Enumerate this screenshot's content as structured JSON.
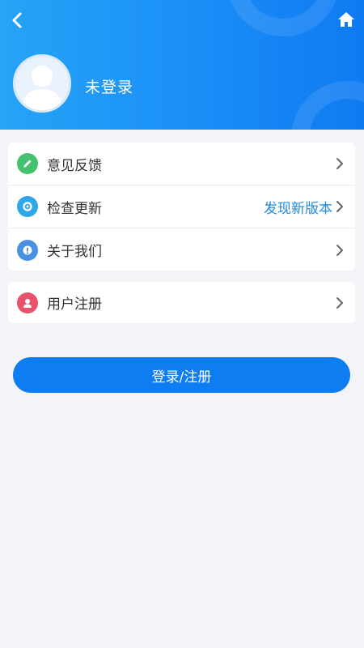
{
  "header": {
    "status": "未登录",
    "colors": {
      "gradient_start": "#26a4f6",
      "gradient_end": "#0f7af2"
    },
    "icons": {
      "back": "chevron-left-icon",
      "home": "home-icon",
      "avatar": "user-avatar-icon"
    }
  },
  "menu_group_1": [
    {
      "label": "意见反馈",
      "icon": "pencil-icon",
      "icon_color": "#43c16e",
      "value": ""
    },
    {
      "label": "检查更新",
      "icon": "update-icon",
      "icon_color": "#2fa6e6",
      "value": "发现新版本"
    },
    {
      "label": "关于我们",
      "icon": "info-icon",
      "icon_color": "#4a90e2",
      "value": ""
    }
  ],
  "menu_group_2": [
    {
      "label": "用户注册",
      "icon": "user-icon",
      "icon_color": "#e8526b"
    }
  ],
  "login_button": {
    "label": "登录/注册",
    "color": "#0e7df2"
  },
  "accent_color": "#1f8ae0"
}
